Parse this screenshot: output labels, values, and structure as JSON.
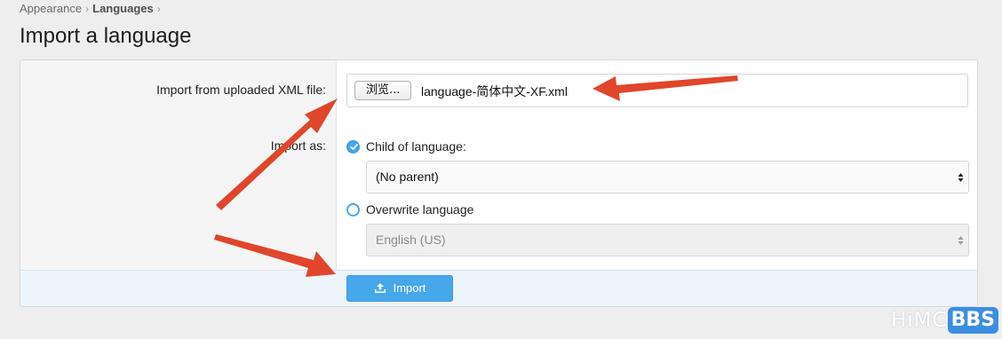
{
  "breadcrumb": {
    "items": [
      "Appearance",
      "Languages"
    ],
    "separator": "›"
  },
  "page_title": "Import a language",
  "form": {
    "file_label": "Import from uploaded XML file:",
    "browse_label": "浏览...",
    "file_name": "language-简体中文-XF.xml",
    "import_as_label": "Import as:",
    "options": [
      {
        "label": "Child of language:",
        "checked": true,
        "select_value": "(No parent)",
        "select_disabled": false
      },
      {
        "label": "Overwrite language",
        "checked": false,
        "select_value": "English (US)",
        "select_disabled": true
      }
    ],
    "submit_label": "Import"
  },
  "watermark": {
    "text": "HiMC",
    "badge": "BBS"
  },
  "colors": {
    "accent": "#47a7eb",
    "annotation_arrow": "#e0462b",
    "footer_bg": "#edf4fb"
  },
  "icons": [
    "chevron-right-icon",
    "check-icon",
    "select-arrows-icon",
    "upload-icon",
    "annotation-arrow-icon"
  ]
}
